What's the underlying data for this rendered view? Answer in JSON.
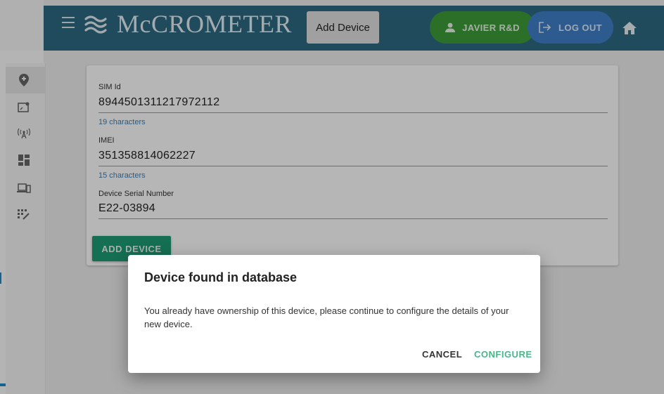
{
  "header": {
    "logo": "McCROMETER",
    "add_device_label": "Add Device",
    "user_label": "JAVIER R&D",
    "logout_label": "LOG OUT"
  },
  "sidebar": {
    "icons": [
      "location-pin-icon",
      "map-icon",
      "antenna-icon",
      "dashboard-icon",
      "devices-icon",
      "grid-edit-icon"
    ]
  },
  "form": {
    "sim": {
      "label": "SIM Id",
      "value": "8944501311217972112",
      "hint": "19 characters"
    },
    "imei": {
      "label": "IMEI",
      "value": "351358814062227",
      "hint": "15 characters"
    },
    "serial": {
      "label": "Device Serial Number",
      "value": "E22-03894"
    },
    "submit_label": "ADD DEVICE"
  },
  "dialog": {
    "title": "Device found in database",
    "body": "You already have ownership of this device, please continue to configure the details of your new device.",
    "cancel_label": "CANCEL",
    "configure_label": "CONFIGURE"
  },
  "colors": {
    "header": "#2c6882",
    "user_button": "#3d9a3a",
    "logout_button": "#3f7fc7",
    "primary_action": "#1e9a72",
    "hint_text": "#3a7fb3"
  }
}
